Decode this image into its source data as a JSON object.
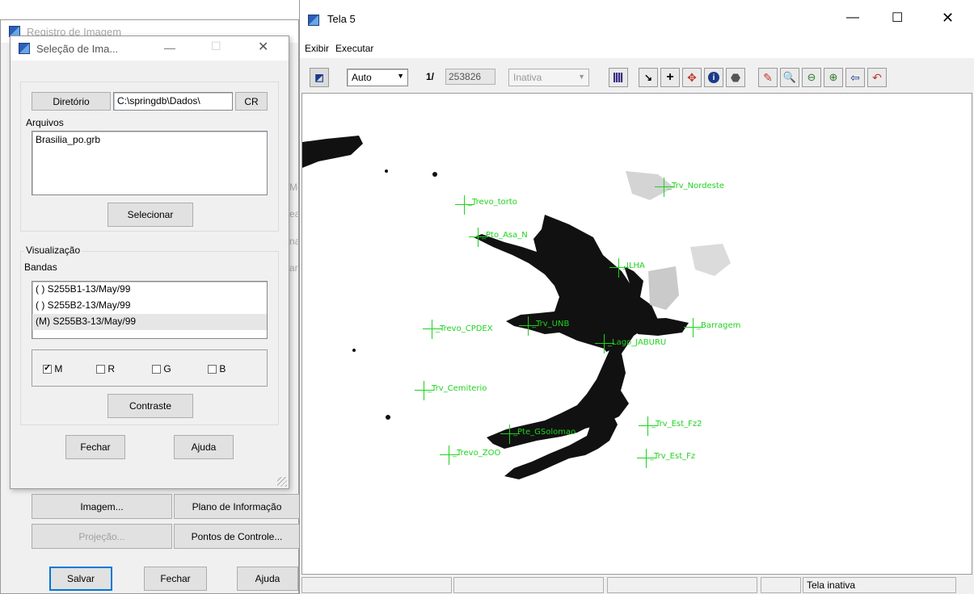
{
  "registro": {
    "title": "Registro de Imagem",
    "buttons": {
      "imagem": "Imagem...",
      "plano": "Plano de Informação",
      "projecao": "Projeção...",
      "pontos": "Pontos de Controle...",
      "salvar": "Salvar",
      "fechar": "Fechar",
      "ajuda": "Ajuda"
    },
    "side_letters": [
      "Mo",
      "ea",
      "na",
      "ar"
    ]
  },
  "selecao": {
    "title": "Seleção de Ima...",
    "diretorio_btn": "Diretório",
    "diretorio_path": "C:\\springdb\\Dados\\",
    "cr_btn": "CR",
    "arquivos_label": "Arquivos",
    "files": [
      "Brasilia_po.grb"
    ],
    "selecionar_btn": "Selecionar",
    "visualizacao_label": "Visualização",
    "bandas_label": "Bandas",
    "bandas": [
      "( ) S255B1-13/May/99",
      "( ) S255B2-13/May/99",
      "(M) S255B3-13/May/99"
    ],
    "checks": [
      {
        "label": "M",
        "checked": true
      },
      {
        "label": "R",
        "checked": false
      },
      {
        "label": "G",
        "checked": false
      },
      {
        "label": "B",
        "checked": false
      }
    ],
    "contraste_btn": "Contraste",
    "fechar_btn": "Fechar",
    "ajuda_btn": "Ajuda"
  },
  "tela": {
    "title": "Tela 5",
    "menu": [
      "Exibir",
      "Executar"
    ],
    "zoom_mode": "Auto",
    "scale_prefix": "1/",
    "scale_value": "253826",
    "state_select": "Inativa",
    "status": "Tela inativa",
    "points": [
      {
        "label": "_Trv_Nordeste"
      },
      {
        "label": "_Trevo_torto"
      },
      {
        "label": "_Pto_Asa_N"
      },
      {
        "label": "_ILHA"
      },
      {
        "label": "_Trevo_CPDEX"
      },
      {
        "label": "_Trv_UNB"
      },
      {
        "label": "_Barragem"
      },
      {
        "label": "_Lago_JABURU"
      },
      {
        "label": "_Trv_Cemiterio"
      },
      {
        "label": "_Pte_GSolomao"
      },
      {
        "label": "_Trevo_ZOO"
      },
      {
        "label": "_Trv_Est_Fz2"
      },
      {
        "label": "_Trv_Est_Fz"
      }
    ]
  }
}
